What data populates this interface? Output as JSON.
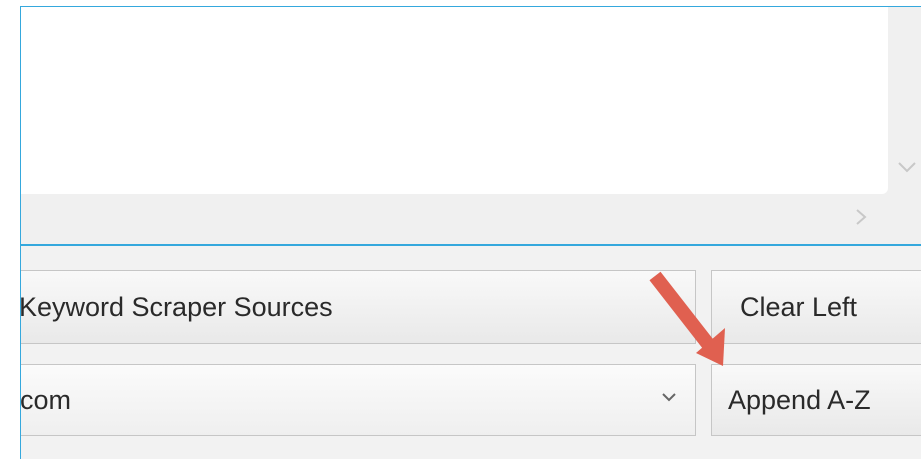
{
  "keyword_list": {
    "value": "",
    "scroll_down_icon": "chevron-down-icon",
    "scroll_right_icon": "chevron-right-icon"
  },
  "buttons": {
    "sources_label": "Keyword Scraper Sources",
    "clear_label": "Clear Left",
    "append_label": "Append A-Z"
  },
  "domain_select": {
    "selected": "com",
    "arrow_icon": "chevron-down-icon"
  },
  "annotation": {
    "arrow_icon": "arrow-pointer-icon",
    "color": "#e06050"
  },
  "colors": {
    "accent": "#35a8dd",
    "button_bg": "#eeeeee",
    "panel_bg": "#f0f0f0"
  }
}
